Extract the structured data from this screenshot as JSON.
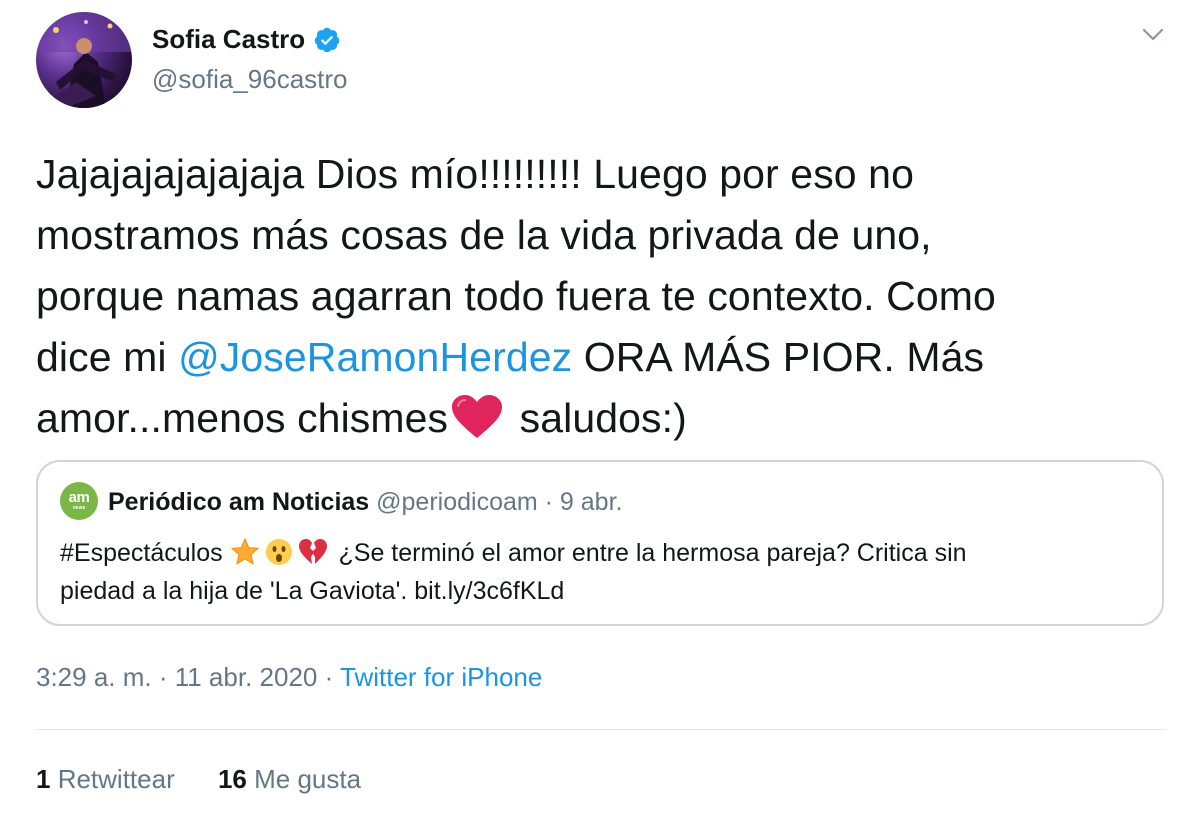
{
  "author": {
    "name": "Sofia Castro",
    "handle": "@sofia_96castro",
    "verified": true
  },
  "tweet": {
    "line1": "Jajajajajajajaja Dios mío!!!!!!!!! Luego por eso no",
    "line2": "mostramos más cosas de la vida privada de uno,",
    "line3": "porque namas agarran todo fuera te contexto. Como",
    "line4_pre": "dice mi ",
    "mention": "@JoseRamonHerdez",
    "line4_post": " ORA MÁS PIOR. Más",
    "line5_pre": "amor...menos chismes",
    "line5_post": " saludos:)"
  },
  "quoted": {
    "avatar_text": "am",
    "avatar_sub": "news",
    "name": "Periódico am Noticias",
    "meta": " @periodicoam · 9 abr.",
    "text_pre": "#Espectáculos ",
    "text_post": " ¿Se terminó el amor entre la hermosa pareja? Critica sin",
    "line2": "piedad a la hija de 'La Gaviota'. bit.ly/3c6fKLd",
    "emojis": [
      "star-icon",
      "astonished-face-icon",
      "broken-heart-icon"
    ]
  },
  "meta": {
    "time": "3:29 a. m. · 11 abr. 2020 · ",
    "source": "Twitter for iPhone"
  },
  "stats": {
    "retweets_count": "1",
    "retweets_label": " Retwittear",
    "likes_count": "16",
    "likes_label": " Me gusta"
  },
  "colors": {
    "link": "#1b95e0",
    "secondary": "#657786",
    "heart": "#e0245e",
    "verified": "#1da1f2",
    "am_brand": "#7ab648"
  }
}
